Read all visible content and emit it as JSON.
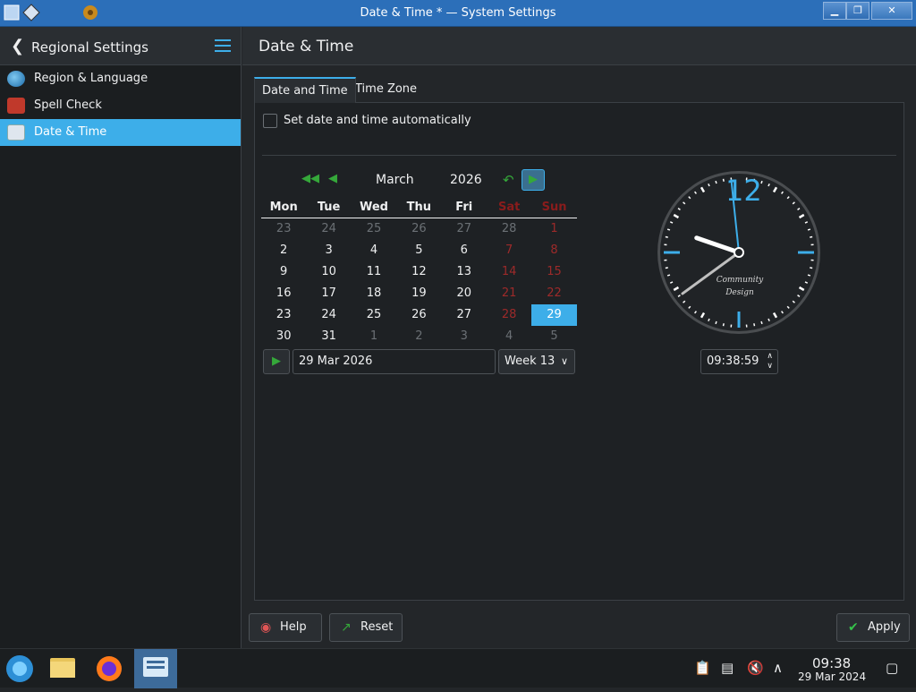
{
  "window": {
    "title": "Date & Time * — System Settings",
    "buttons": [
      "▁",
      "❐",
      "✕"
    ]
  },
  "sidebar": {
    "header": "Regional Settings",
    "items": [
      {
        "label": "Region & Language",
        "icon": "globe-icon"
      },
      {
        "label": "Spell Check",
        "icon": "spellcheck-icon"
      },
      {
        "label": "Date & Time",
        "icon": "calendar-icon",
        "active": true
      }
    ]
  },
  "main": {
    "title": "Date & Time",
    "tabs": [
      "Date and Time",
      "Time Zone"
    ],
    "auto_label": "Set date and time automatically"
  },
  "calendar": {
    "month": "March",
    "year": "2026",
    "headers": [
      "Mon",
      "Tue",
      "Wed",
      "Thu",
      "Fri",
      "Sat",
      "Sun"
    ],
    "weeks": [
      [
        "23",
        "24",
        "25",
        "26",
        "27",
        "28",
        "1"
      ],
      [
        "2",
        "3",
        "4",
        "5",
        "6",
        "7",
        "8"
      ],
      [
        "9",
        "10",
        "11",
        "12",
        "13",
        "14",
        "15"
      ],
      [
        "16",
        "17",
        "18",
        "19",
        "20",
        "21",
        "22"
      ],
      [
        "23",
        "24",
        "25",
        "26",
        "27",
        "28",
        "29"
      ],
      [
        "30",
        "31",
        "1",
        "2",
        "3",
        "4",
        "5"
      ]
    ],
    "selected": "29",
    "date_value": "29 Mar 2026",
    "week_value": "Week 13"
  },
  "clock": {
    "face_number": "12",
    "brand_line1": "Community",
    "brand_line2": "Design",
    "time_value": "09:38:59",
    "hour": 9,
    "minute": 38,
    "second": 59
  },
  "buttons": {
    "help": "Help",
    "reset": "Reset",
    "apply": "Apply"
  },
  "taskbar": {
    "time": "09:38",
    "date": "29 Mar 2024"
  },
  "colors": {
    "accent": "#3daee9",
    "weekend": "#9d2a2a",
    "nav_green": "#35a83a"
  }
}
